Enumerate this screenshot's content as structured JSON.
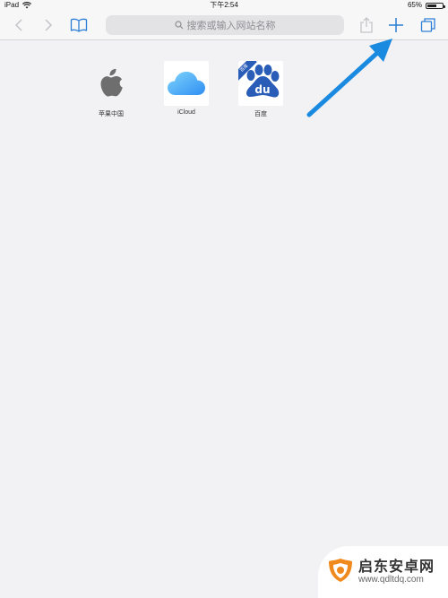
{
  "status_bar": {
    "device": "iPad",
    "time": "下午2:54",
    "battery": "65%",
    "battery_level": 0.65
  },
  "toolbar": {
    "search_placeholder": "搜索或输入网站名称"
  },
  "favorites": [
    {
      "label": "苹果中国",
      "icon": "apple-logo-icon"
    },
    {
      "label": "iCloud",
      "icon": "icloud-icon"
    },
    {
      "label": "百度",
      "icon": "baidu-paw-icon",
      "badge": "百度"
    }
  ],
  "colors": {
    "accent": "#2d7fd6",
    "annotation_arrow": "#1a8ae0",
    "baidu_blue": "#2a5db8",
    "watermark_orange": "#f08a1e"
  },
  "watermark": {
    "title": "启东安卓网",
    "url": "www.qdltdq.com"
  }
}
